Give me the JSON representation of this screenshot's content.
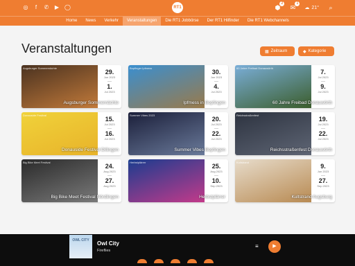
{
  "topbar": {
    "social_icons": [
      "instagram-icon",
      "facebook-icon",
      "phone-icon",
      "youtube-icon",
      "whatsapp-icon"
    ],
    "logo_text": "RT1",
    "notif_count": "2",
    "chat_count": "1",
    "temperature": "21°",
    "accent": "#ef7d31"
  },
  "nav": {
    "items": [
      "Home",
      "News",
      "Verkehr",
      "Veranstaltungen",
      "Die RT1 Jobbörse",
      "Der RT1 Hilfinder",
      "Die RT1 Webchannels"
    ],
    "active": "Veranstaltungen"
  },
  "page": {
    "title": "Veranstaltungen",
    "filter_time": "Zeitraum",
    "filter_category": "Kategorie"
  },
  "events": [
    {
      "title": "Augsburger Sommernächte",
      "category": "Augsburger Sommernächte",
      "start_day": "29.",
      "start_mon": "Jun 2023",
      "end_day": "1.",
      "end_mon": "Jul 2023",
      "colors": [
        "#4a3220",
        "#c27a3a"
      ]
    },
    {
      "title": "Ipfmess in Bopfingen",
      "category": "Bopfinger Ipfmess",
      "start_day": "30.",
      "start_mon": "Jun 2023",
      "end_day": "4.",
      "end_mon": "Jul 2023",
      "colors": [
        "#3a8fd0",
        "#9a7a4a"
      ]
    },
    {
      "title": "60 Jahre Freibad Donauwörth",
      "category": "60 Jahre Freibad Donauwörth",
      "start_day": "7.",
      "start_mon": "Jul 2023",
      "end_day": "9.",
      "end_mon": "Jul 2023",
      "colors": [
        "#7aaed8",
        "#3b5d2b"
      ]
    },
    {
      "title": "Donauside Festival Dillingen",
      "category": "Donauside Festival",
      "start_day": "15.",
      "start_mon": "Jul 2023",
      "end_day": "16.",
      "end_mon": "Jul 2023",
      "colors": [
        "#f0d23a",
        "#e8b32a"
      ]
    },
    {
      "title": "Summer Vibes Bopfingen",
      "category": "Summer Vibes 2023",
      "start_day": "20.",
      "start_mon": "Jul 2023",
      "end_day": "22.",
      "end_mon": "Jul 2023",
      "colors": [
        "#1b1f3a",
        "#6a7a9a"
      ]
    },
    {
      "title": "Reichsstraßenfest Donauwörth",
      "category": "Reichsstraßenfest",
      "start_day": "19.",
      "start_mon": "Jul 2023",
      "end_day": "22.",
      "end_mon": "Jul 2023",
      "colors": [
        "#2d3340",
        "#5e6574"
      ]
    },
    {
      "title": "Big Bike Meet Festival Nördlingen",
      "category": "Big Bike Meet Festival",
      "start_day": "24.",
      "start_mon": "Aug 2023",
      "end_day": "27.",
      "end_mon": "Aug 2023",
      "colors": [
        "#2a2a2a",
        "#7a7a7a"
      ]
    },
    {
      "title": "Herbstplärrer",
      "category": "Herbstplärrer",
      "start_day": "25.",
      "start_mon": "Aug 2023",
      "end_day": "10.",
      "end_mon": "Sep 2023",
      "colors": [
        "#1a3d8f",
        "#c33a8a"
      ]
    },
    {
      "title": "Kultstrand Augsburg",
      "category": "Kultstrand",
      "start_day": "9.",
      "start_mon": "Jun 2023",
      "end_day": "27.",
      "end_mon": "Sep 2023",
      "colors": [
        "#e7dccb",
        "#b88a52"
      ]
    }
  ],
  "player": {
    "cover_text": "OWL CITY",
    "artist": "Owl City",
    "song": "Fireflies"
  }
}
